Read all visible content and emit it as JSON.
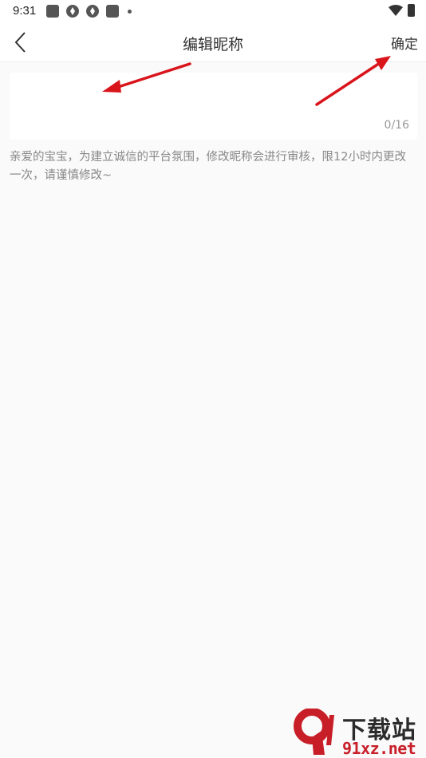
{
  "status_bar": {
    "time": "9:31",
    "left_icons": [
      "notification-square-icon",
      "app-shutter-icon",
      "app-shutter-icon",
      "notification-square-icon",
      "dot-icon"
    ],
    "right_icons": [
      "wifi-icon",
      "battery-charging-icon"
    ]
  },
  "header": {
    "title": "编辑昵称",
    "back_icon": "chevron-left-icon",
    "confirm_label": "确定"
  },
  "nickname_field": {
    "value": "",
    "placeholder": "",
    "counter": "0/16"
  },
  "hint": "亲爱的宝宝，为建立诚信的平台氛围，修改昵称会进行审核，限12小时内更改一次，请谨慎修改~",
  "annotation_color": "#d9141b",
  "watermark": {
    "logo": "9",
    "top_text": "下载站",
    "bottom_text": "91xz.net"
  }
}
